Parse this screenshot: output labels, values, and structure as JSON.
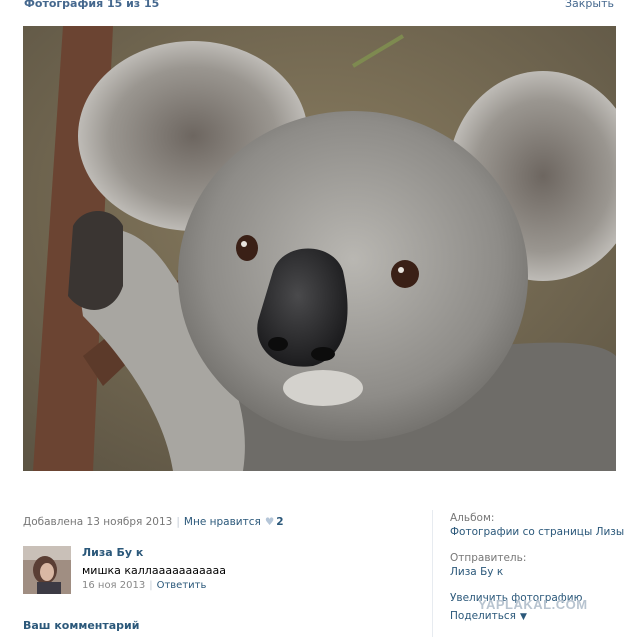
{
  "header": {
    "title": "Фотография 15 из 15",
    "close_label": "Закрыть"
  },
  "photo": {
    "subject": "koala"
  },
  "meta": {
    "added": "Добавлена 13 ноября 2013",
    "like_label": "Мне нравится",
    "like_count": "2",
    "heart_icon": "heart-icon"
  },
  "comment": {
    "author": "Лиза Бу к",
    "text": "мишка каллааааааааааа",
    "date": "16 ноя 2013",
    "reply_label": "Ответить"
  },
  "your_comment_label": "Ваш комментарий",
  "sidebar": {
    "album_label": "Альбом:",
    "album_value": "Фотографии со страницы Лизы",
    "sender_label": "Отправитель:",
    "sender_value": "Лиза Бу к",
    "enlarge_label": "Увеличить фотографию",
    "share_label": "Поделиться"
  },
  "watermark": "YAPLAKAL.COM",
  "colors": {
    "link": "#2b587a",
    "header_link": "#45688e",
    "muted": "#777777"
  }
}
